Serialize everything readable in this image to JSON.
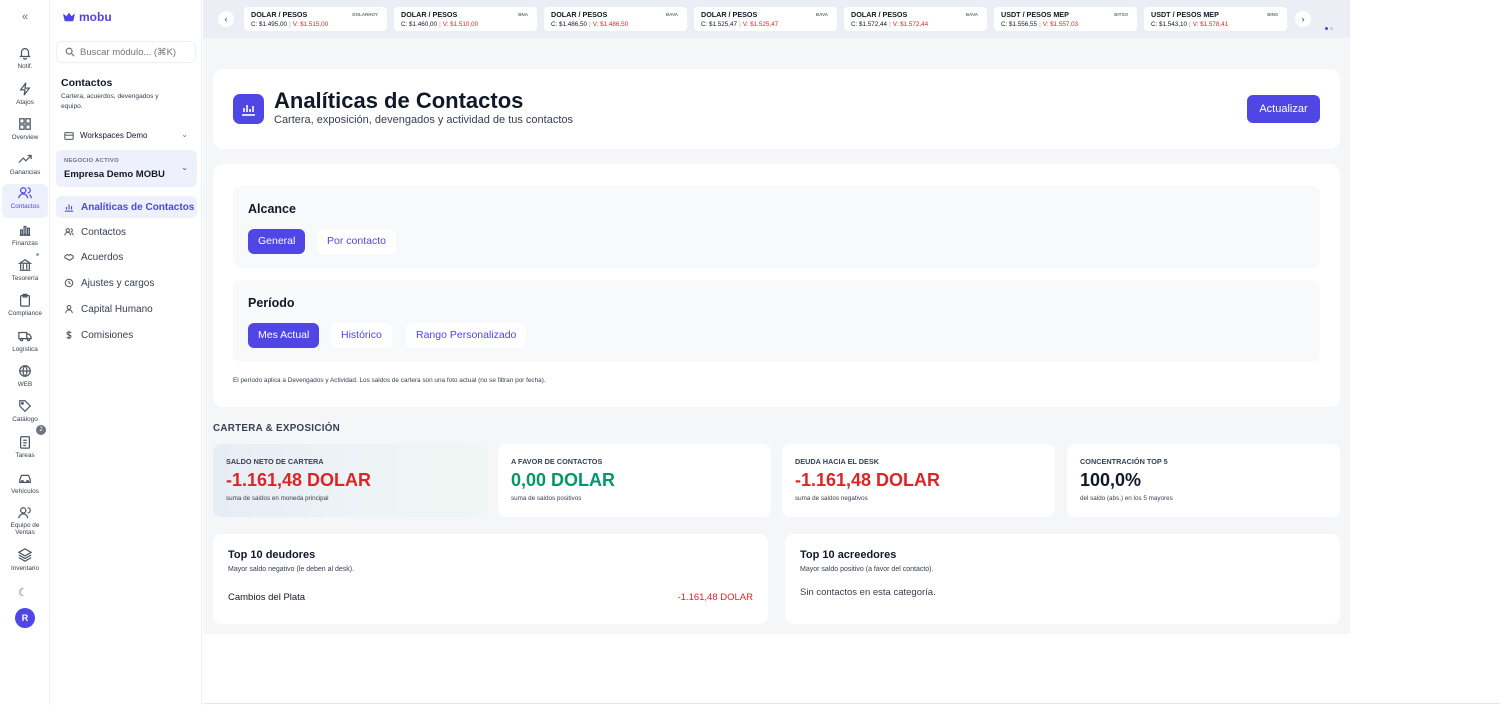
{
  "rail": {
    "items": [
      {
        "label": "Notif.",
        "icon": "bell-icon"
      },
      {
        "label": "Atajos",
        "icon": "lightning-icon"
      },
      {
        "label": "Overview",
        "icon": "grid-icon"
      },
      {
        "label": "Ganancias",
        "icon": "trend-icon"
      },
      {
        "label": "Contactos",
        "icon": "users-icon",
        "active": true
      },
      {
        "label": "Finanzas",
        "icon": "chart-icon"
      },
      {
        "label": "Tesorería",
        "icon": "bank-icon"
      },
      {
        "label": "Compliance",
        "icon": "clipboard-icon"
      },
      {
        "label": "Logística",
        "icon": "box-icon"
      },
      {
        "label": "WEB",
        "icon": "globe-icon"
      },
      {
        "label": "Catálogo",
        "icon": "tag-icon"
      },
      {
        "label": "Tareas",
        "icon": "checklist-icon",
        "badge": "2"
      },
      {
        "label": "Vehículos",
        "icon": "car-icon"
      },
      {
        "label": "Equipo de Ventas",
        "icon": "team-icon"
      },
      {
        "label": "Inventario",
        "icon": "layers-icon"
      }
    ],
    "avatar": "R"
  },
  "sidebar": {
    "logo": "mobu",
    "search_placeholder": "Buscar módulo... (⌘K)",
    "section_title": "Contactos",
    "section_subtitle": "Cartera, acuerdos, devengados y equipo.",
    "workspace": "Workspaces Demo",
    "business_label": "NEGOCIO ACTIVO",
    "business_name": "Empresa Demo MOBU",
    "nav": [
      {
        "label": "Analíticas de Contactos",
        "active": true
      },
      {
        "label": "Contactos"
      },
      {
        "label": "Acuerdos"
      },
      {
        "label": "Ajustes y cargos"
      },
      {
        "label": "Capital Humano"
      },
      {
        "label": "Comisiones"
      }
    ]
  },
  "ticker": [
    {
      "pair": "DOLAR / PESOS",
      "source": "DOLARHOY",
      "buy": "C: $1.495,00",
      "sell": "V: $1.515,00"
    },
    {
      "pair": "DOLAR / PESOS",
      "source": "BNA",
      "buy": "C: $1.460,00",
      "sell": "V: $1.510,00"
    },
    {
      "pair": "DOLAR / PESOS",
      "source": "BAVA",
      "buy": "C: $1.486,50",
      "sell": "V: $1.486,50"
    },
    {
      "pair": "DOLAR / PESOS",
      "source": "BAVA",
      "buy": "C: $1.525,47",
      "sell": "V: $1.525,47"
    },
    {
      "pair": "DOLAR / PESOS",
      "source": "BAVA",
      "buy": "C: $1.572,44",
      "sell": "V: $1.572,44"
    },
    {
      "pair": "USDT / PESOS MEP",
      "source": "BITSO",
      "buy": "C: $1.556,55",
      "sell": "V: $1.557,03"
    },
    {
      "pair": "USDT / PESOS MEP",
      "source": "BINS",
      "buy": "C: $1.543,10",
      "sell": "V: $1.578,41"
    }
  ],
  "header": {
    "title": "Analíticas de Contactos",
    "subtitle": "Cartera, exposición, devengados y actividad de tus contactos",
    "update_button": "Actualizar"
  },
  "filters": {
    "scope_title": "Alcance",
    "scope_options": [
      "General",
      "Por contacto"
    ],
    "period_title": "Período",
    "period_options": [
      "Mes Actual",
      "Histórico",
      "Rango Personalizado"
    ],
    "note": "El período aplica a Devengados y Actividad. Los saldos de cartera son una foto actual (no se filtran por fecha)."
  },
  "portfolio": {
    "section_title": "CARTERA & EXPOSICIÓN",
    "kpis": [
      {
        "label": "SALDO NETO DE CARTERA",
        "value": "-1.161,48 DOLAR",
        "sub": "suma de saldos en moneda principal",
        "tone": "neg"
      },
      {
        "label": "A FAVOR DE CONTACTOS",
        "value": "0,00 DOLAR",
        "sub": "suma de saldos positivos",
        "tone": "pos"
      },
      {
        "label": "DEUDA HACIA EL DESK",
        "value": "-1.161,48 DOLAR",
        "sub": "suma de saldos negativos",
        "tone": "neg"
      },
      {
        "label": "CONCENTRACIÓN TOP 5",
        "value": "100,0%",
        "sub": "del saldo (abs.) en los 5 mayores",
        "tone": "neutral"
      }
    ]
  },
  "top_debtors": {
    "title": "Top 10 deudores",
    "subtitle": "Mayor saldo negativo (le deben al desk).",
    "rows": [
      {
        "name": "Cambios del Plata",
        "value": "-1.161,48 DOLAR"
      }
    ]
  },
  "top_creditors": {
    "title": "Top 10 acreedores",
    "subtitle": "Mayor saldo positivo (a favor del contacto).",
    "empty": "Sin contactos en esta categoría."
  },
  "colors": {
    "accent": "#4f46e5",
    "negative": "#dc2626",
    "positive": "#059669"
  }
}
